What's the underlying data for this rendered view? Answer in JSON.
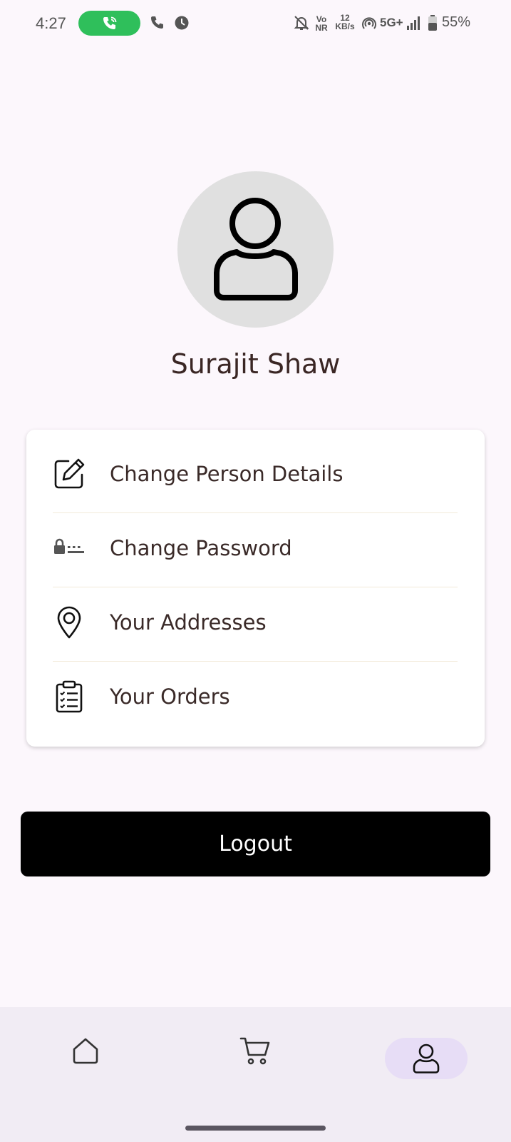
{
  "status_bar": {
    "time": "4:27",
    "network_speed_value": "12",
    "network_speed_unit": "KB/s",
    "volte_top": "Vo",
    "volte_bottom": "NR",
    "network_type": "5G+",
    "battery_percent": "55%",
    "icons": [
      "call-active-icon",
      "phone-icon",
      "vpn-icon",
      "mute-icon",
      "volte-icon",
      "hotspot-icon",
      "signal-icon",
      "battery-icon"
    ]
  },
  "profile": {
    "name": "Surajit Shaw",
    "avatar_icon": "person-icon"
  },
  "menu": {
    "items": [
      {
        "label": "Change Person Details",
        "icon": "edit-icon"
      },
      {
        "label": "Change Password",
        "icon": "password-icon"
      },
      {
        "label": "Your Addresses",
        "icon": "location-pin-icon"
      },
      {
        "label": "Your Orders",
        "icon": "clipboard-list-icon"
      }
    ]
  },
  "logout_label": "Logout",
  "bottom_nav": {
    "items": [
      {
        "icon": "home-icon",
        "active": false
      },
      {
        "icon": "cart-icon",
        "active": false
      },
      {
        "icon": "profile-icon",
        "active": true
      }
    ]
  },
  "colors": {
    "background": "#fcf7fc",
    "text": "#3a2a28",
    "logout_bg": "#000000",
    "call_pill": "#2fbf5b",
    "nav_bg": "#f1ecf4",
    "nav_active": "#e7ddf6"
  }
}
